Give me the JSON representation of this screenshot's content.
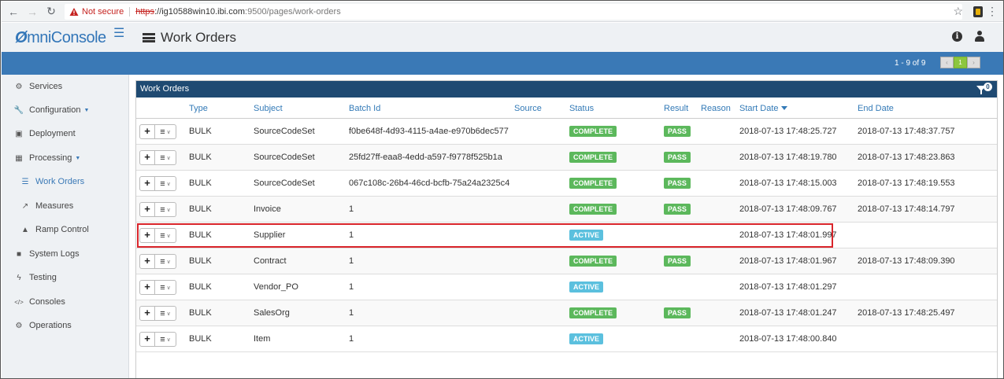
{
  "browser": {
    "not_secure": "Not secure",
    "url_scheme": "https",
    "url_host": "://ig10588win10.ibi.com",
    "url_rest": ":9500/pages/work-orders"
  },
  "app": {
    "logo": "OmniConsole",
    "page_title": "Work Orders"
  },
  "paging": {
    "text": "1 - 9 of 9",
    "prev": "‹",
    "current": "1",
    "next": "›"
  },
  "sidebar": {
    "items": [
      {
        "label": "Services",
        "icon": "cogs-icon"
      },
      {
        "label": "Configuration",
        "icon": "wrench-icon",
        "caret": true
      },
      {
        "label": "Deployment",
        "icon": "cube-icon"
      },
      {
        "label": "Processing",
        "icon": "table-icon",
        "caret": true
      },
      {
        "label": "Work Orders",
        "icon": "list-icon",
        "active": true
      },
      {
        "label": "Measures",
        "icon": "area-chart-icon"
      },
      {
        "label": "Ramp Control",
        "icon": "road-icon"
      },
      {
        "label": "System Logs",
        "icon": "file-icon"
      },
      {
        "label": "Testing",
        "icon": "flash-icon"
      },
      {
        "label": "Consoles",
        "icon": "code-icon"
      },
      {
        "label": "Operations",
        "icon": "gears-icon"
      }
    ]
  },
  "panel": {
    "title": "Work Orders",
    "filter_count": "0",
    "columns": [
      "Type",
      "Subject",
      "Batch Id",
      "Source",
      "Status",
      "Result",
      "Reason",
      "Start Date",
      "End Date"
    ],
    "rows": [
      {
        "type": "BULK",
        "subject": "SourceCodeSet",
        "batch_id": "f0be648f-4d93-4115-a4ae-e970b6dec577",
        "source": "",
        "status": "COMPLETE",
        "result": "PASS",
        "reason": "",
        "start": "2018-07-13 17:48:25.727",
        "end": "2018-07-13 17:48:37.757"
      },
      {
        "type": "BULK",
        "subject": "SourceCodeSet",
        "batch_id": "25fd27ff-eaa8-4edd-a597-f9778f525b1a",
        "source": "",
        "status": "COMPLETE",
        "result": "PASS",
        "reason": "",
        "start": "2018-07-13 17:48:19.780",
        "end": "2018-07-13 17:48:23.863"
      },
      {
        "type": "BULK",
        "subject": "SourceCodeSet",
        "batch_id": "067c108c-26b4-46cd-bcfb-75a24a2325c4",
        "source": "",
        "status": "COMPLETE",
        "result": "PASS",
        "reason": "",
        "start": "2018-07-13 17:48:15.003",
        "end": "2018-07-13 17:48:19.553"
      },
      {
        "type": "BULK",
        "subject": "Invoice",
        "batch_id": "1",
        "source": "",
        "status": "COMPLETE",
        "result": "PASS",
        "reason": "",
        "start": "2018-07-13 17:48:09.767",
        "end": "2018-07-13 17:48:14.797"
      },
      {
        "type": "BULK",
        "subject": "Supplier",
        "batch_id": "1",
        "source": "",
        "status": "ACTIVE",
        "result": "",
        "reason": "",
        "start": "2018-07-13 17:48:01.997",
        "end": ""
      },
      {
        "type": "BULK",
        "subject": "Contract",
        "batch_id": "1",
        "source": "",
        "status": "COMPLETE",
        "result": "PASS",
        "reason": "",
        "start": "2018-07-13 17:48:01.967",
        "end": "2018-07-13 17:48:09.390"
      },
      {
        "type": "BULK",
        "subject": "Vendor_PO",
        "batch_id": "1",
        "source": "",
        "status": "ACTIVE",
        "result": "",
        "reason": "",
        "start": "2018-07-13 17:48:01.297",
        "end": ""
      },
      {
        "type": "BULK",
        "subject": "SalesOrg",
        "batch_id": "1",
        "source": "",
        "status": "COMPLETE",
        "result": "PASS",
        "reason": "",
        "start": "2018-07-13 17:48:01.247",
        "end": "2018-07-13 17:48:25.497"
      },
      {
        "type": "BULK",
        "subject": "Item",
        "batch_id": "1",
        "source": "",
        "status": "ACTIVE",
        "result": "",
        "reason": "",
        "start": "2018-07-13 17:48:00.840",
        "end": ""
      }
    ]
  },
  "colors": {
    "accent": "#3a79b6",
    "panel_header": "#1f4a72",
    "complete": "#5cb85c",
    "active": "#5bc0de",
    "highlight": "#d9252b"
  }
}
